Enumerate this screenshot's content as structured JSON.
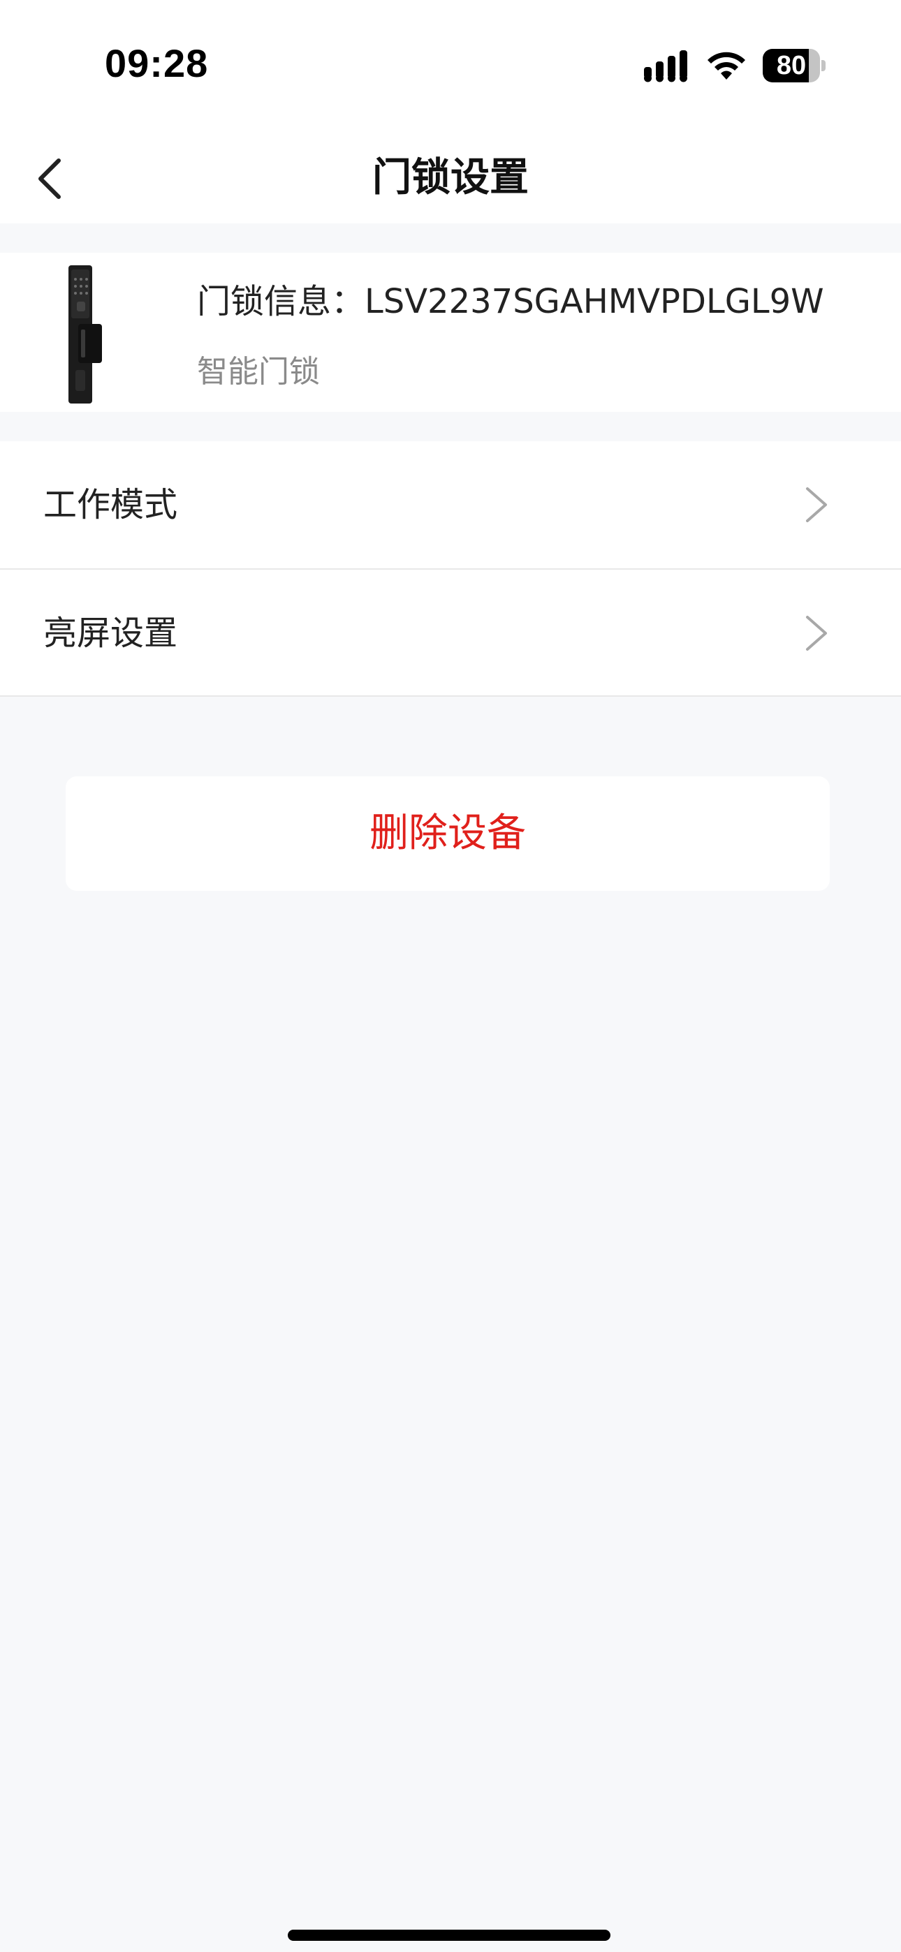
{
  "status_bar": {
    "time": "09:28",
    "battery_level": "80",
    "battery_fraction": 0.8
  },
  "nav": {
    "title": "门锁设置"
  },
  "device": {
    "name": "门锁信息：LSV2237SGAHMVPDLGL9W",
    "type": "智能门锁"
  },
  "settings": {
    "items": [
      {
        "label": "工作模式"
      },
      {
        "label": "亮屏设置"
      }
    ]
  },
  "actions": {
    "delete_label": "删除设备"
  },
  "colors": {
    "danger": "#e0201b",
    "background": "#f7f8fa",
    "card": "#ffffff",
    "secondary_text": "#8a8a8a"
  }
}
